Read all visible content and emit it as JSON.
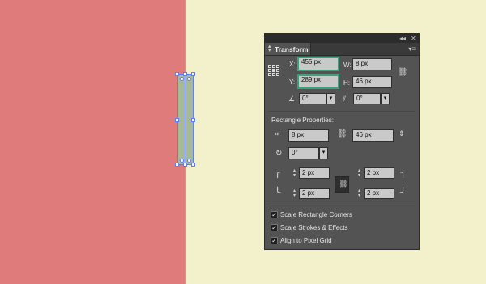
{
  "panel": {
    "title": "Transform",
    "x_label": "X:",
    "x_value": "455 px",
    "y_label": "Y:",
    "y_value": "289 px",
    "w_label": "W:",
    "w_value": "8 px",
    "h_label": "H:",
    "h_value": "46 px",
    "rotate_value": "0°",
    "shear_value": "0°",
    "rect_props_title": "Rectangle Properties:",
    "rect_width_value": "8 px",
    "rect_height_value": "46 px",
    "rect_angle_value": "0°",
    "corner_tl": "2 px",
    "corner_tr": "2 px",
    "corner_bl": "2 px",
    "corner_br": "2 px",
    "opt_scale_corners": "Scale Rectangle Corners",
    "opt_scale_strokes": "Scale Strokes & Effects",
    "opt_align_pixel": "Align to Pixel Grid",
    "collapse_glyph": "◂◂",
    "close_glyph": "✕",
    "menu_glyph": "▾≡",
    "check_glyph": "✓",
    "dropdown_glyph": "▾"
  },
  "colors": {
    "left_artboard": "#df7c7b",
    "canvas": "#f3f0cc",
    "selection": "#5d7cff",
    "active_field_border": "#3aa17a"
  }
}
